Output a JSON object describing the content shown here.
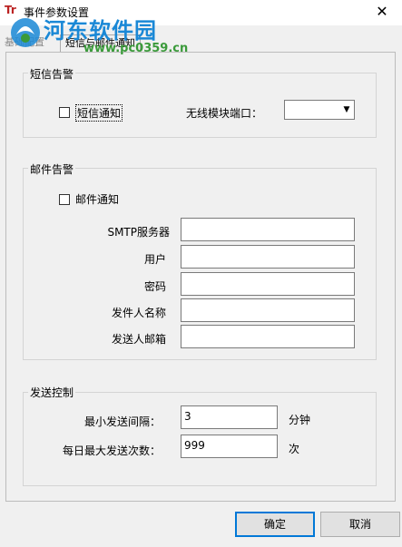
{
  "window": {
    "title": "事件参数设置",
    "close_glyph": "✕"
  },
  "watermark": {
    "main": "河东软件园",
    "url": "www.pc0359.cn"
  },
  "tabs": [
    {
      "label": "基础配置"
    },
    {
      "label": "短信与邮件通知"
    }
  ],
  "sms": {
    "group_title": "短信告警",
    "notify_label": "短信通知",
    "port_label": "无线模块端口：",
    "port_value": ""
  },
  "email": {
    "group_title": "邮件告警",
    "notify_label": "邮件通知",
    "smtp_label": "SMTP服务器",
    "user_label": "用户",
    "password_label": "密码",
    "sender_name_label": "发件人名称",
    "sender_mail_label": "发送人邮箱",
    "smtp_value": "",
    "user_value": "",
    "password_value": "",
    "sender_name_value": "",
    "sender_mail_value": ""
  },
  "send": {
    "group_title": "发送控制",
    "interval_label": "最小发送间隔：",
    "interval_value": "3",
    "interval_unit": "分钟",
    "max_label": "每日最大发送次数：",
    "max_value": "999",
    "max_unit": "次"
  },
  "buttons": {
    "ok": "确定",
    "cancel": "取消"
  },
  "colors": {
    "watermark_blue": "#1a88d6",
    "watermark_green": "#3a9a3a",
    "focus_border": "#0078d7"
  }
}
